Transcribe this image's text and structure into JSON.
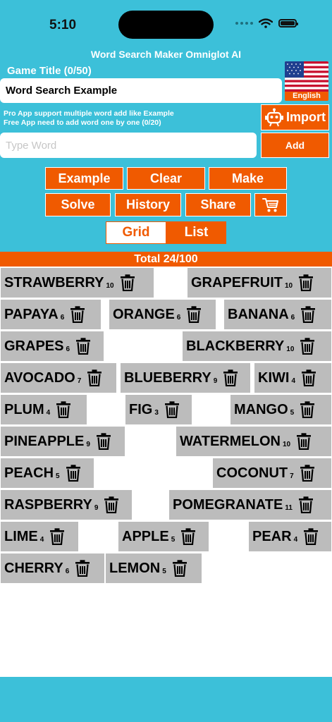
{
  "status_bar": {
    "time": "5:10"
  },
  "header": {
    "app_title": "Word Search Maker Omniglot AI",
    "game_title_label": "Game Title (0/50)",
    "game_title_value": "Word Search Example",
    "language": "English"
  },
  "notes": {
    "line1": "Pro App support multiple word add like Example",
    "line2": "Free App need to add word one by one (0/20)"
  },
  "buttons": {
    "import": "Import",
    "add": "Add",
    "example": "Example",
    "clear": "Clear",
    "make": "Make",
    "solve": "Solve",
    "history": "History",
    "share": "Share"
  },
  "word_input": {
    "placeholder": "Type Word",
    "value": ""
  },
  "view_toggle": {
    "grid": "Grid",
    "list": "List",
    "selected": "Grid"
  },
  "total": "Total 24/100",
  "words": [
    {
      "word": "STRAWBERRY",
      "len": "10"
    },
    {
      "word": "GRAPEFRUIT",
      "len": "10"
    },
    {
      "word": "PAPAYA",
      "len": "6"
    },
    {
      "word": "ORANGE",
      "len": "6"
    },
    {
      "word": "BANANA",
      "len": "6"
    },
    {
      "word": "GRAPES",
      "len": "6"
    },
    {
      "word": "BLACKBERRY",
      "len": "10"
    },
    {
      "word": "AVOCADO",
      "len": "7"
    },
    {
      "word": "BLUEBERRY",
      "len": "9"
    },
    {
      "word": "KIWI",
      "len": "4"
    },
    {
      "word": "PLUM",
      "len": "4"
    },
    {
      "word": "FIG",
      "len": "3"
    },
    {
      "word": "MANGO",
      "len": "5"
    },
    {
      "word": "PINEAPPLE",
      "len": "9"
    },
    {
      "word": "WATERMELON",
      "len": "10"
    },
    {
      "word": "PEACH",
      "len": "5"
    },
    {
      "word": "COCONUT",
      "len": "7"
    },
    {
      "word": "RASPBERRY",
      "len": "9"
    },
    {
      "word": "POMEGRANATE",
      "len": "11"
    },
    {
      "word": "LIME",
      "len": "4"
    },
    {
      "word": "APPLE",
      "len": "5"
    },
    {
      "word": "PEAR",
      "len": "4"
    },
    {
      "word": "CHERRY",
      "len": "6"
    },
    {
      "word": "LEMON",
      "len": "5"
    }
  ],
  "colors": {
    "accent": "#f05a00",
    "header_bg": "#3cc0d9",
    "chip_bg": "#bcbcbc"
  }
}
